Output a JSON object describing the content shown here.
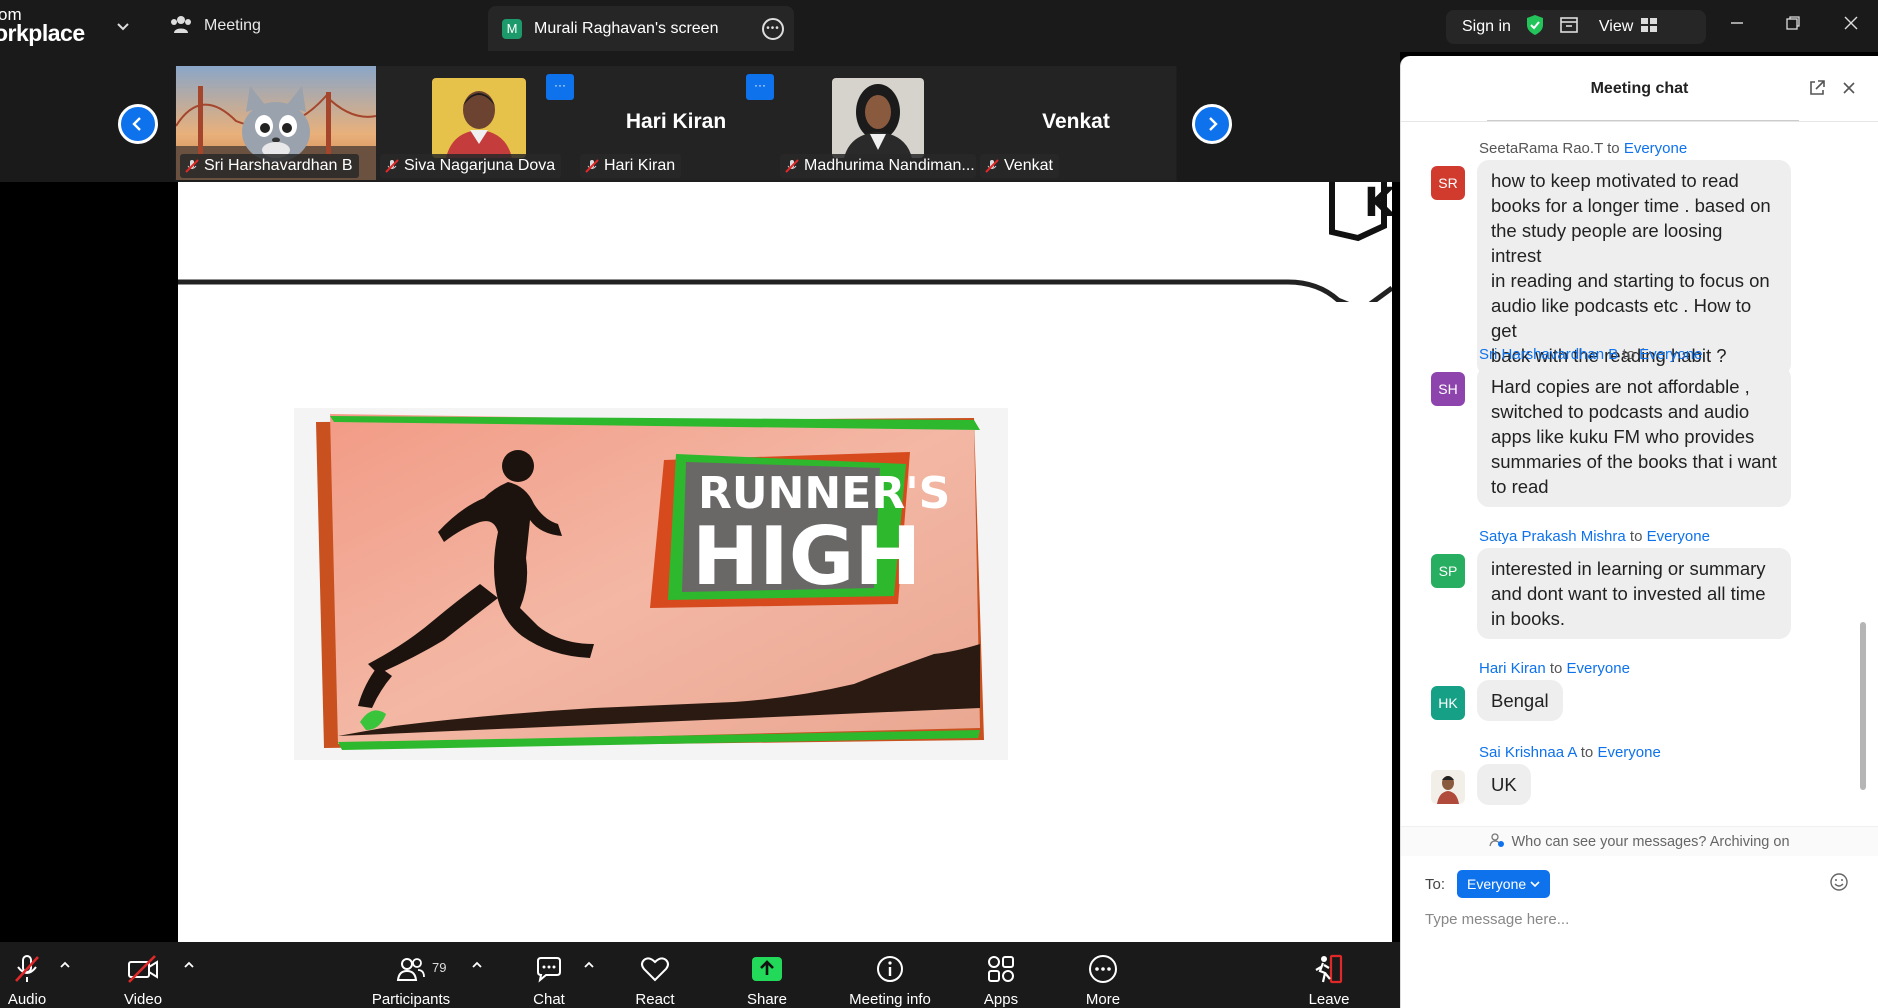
{
  "topbar": {
    "logo_line1": "om",
    "logo_line2": "orkplace",
    "meeting_label": "Meeting",
    "screen_tab_badge": "M",
    "screen_tab_label": "Murali Raghavan's screen",
    "sign_in": "Sign in",
    "view_label": "View"
  },
  "participants_strip": [
    {
      "name": "Sri Harshavardhan B",
      "type": "video"
    },
    {
      "name": "Siva Nagarjuna Dova",
      "type": "photo"
    },
    {
      "name": "Hari Kiran",
      "big_name": "Hari Kiran",
      "type": "name"
    },
    {
      "name": "Madhurima Nandiman...",
      "type": "photo"
    },
    {
      "name": "Venkat",
      "big_name": "Venkat",
      "type": "name"
    }
  ],
  "tile_more": "···",
  "slide": {
    "title_line1": "RUNNER'S",
    "title_line2": "HIGH"
  },
  "chat": {
    "title": "Meeting chat",
    "to_word": "to",
    "messages": [
      {
        "sender": "SeetaRama Rao.T",
        "recipient": "Everyone",
        "initials": "SR",
        "color": "#d13b2e",
        "lines": [
          "how to keep motivated to read",
          "books for a longer time . based on",
          "the study people are loosing intrest",
          "in reading and  starting to focus on",
          "audio like podcasts etc . How to get",
          "back with the reading habit ?"
        ]
      },
      {
        "sender": "Sri Harshavardhan B",
        "recipient": "Everyone",
        "initials": "SH",
        "color": "#8e44ad",
        "lines": [
          "Hard copies are not affordable ,",
          "switched to podcasts and audio",
          "apps like kuku FM who provides",
          "summaries of the books that i want",
          "to read"
        ]
      },
      {
        "sender": "Satya Prakash Mishra",
        "recipient": "Everyone",
        "initials": "SP",
        "color": "#27ae60",
        "lines": [
          "interested  in learning or summary",
          "and dont want to invested all time",
          "in books."
        ]
      },
      {
        "sender": "Hari Kiran",
        "recipient": "Everyone",
        "initials": "HK",
        "color": "#16a085",
        "lines": [
          "Bengal"
        ]
      },
      {
        "sender": "Sai Krishnaa A",
        "recipient": "Everyone",
        "initials": "",
        "color": "#ffffff",
        "lines": [
          "UK"
        ]
      }
    ],
    "archive_notice": "Who can see your messages? Archiving on",
    "to_label": "To:",
    "to_value": "Everyone",
    "input_placeholder": "Type message here..."
  },
  "toolbar": {
    "audio": "Audio",
    "video": "Video",
    "participants": "Participants",
    "participants_count": "79",
    "chat": "Chat",
    "react": "React",
    "share": "Share",
    "meeting_info": "Meeting info",
    "apps": "Apps",
    "more": "More",
    "leave": "Leave"
  },
  "colors": {
    "accent": "#0e72ed",
    "share_green": "#23d959",
    "leave_red": "#e02828"
  }
}
